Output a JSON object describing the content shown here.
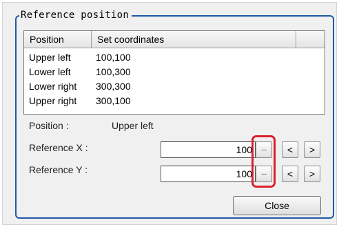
{
  "group": {
    "title": "Reference position"
  },
  "list": {
    "columns": [
      "Position",
      "Set coordinates",
      ""
    ],
    "rows": [
      {
        "position": "Upper left",
        "coords": "100,100"
      },
      {
        "position": "Lower left",
        "coords": "100,300"
      },
      {
        "position": "Lower right",
        "coords": "300,300"
      },
      {
        "position": "Upper right",
        "coords": "300,100"
      }
    ]
  },
  "position_info": {
    "label": "Position :",
    "value": "Upper left"
  },
  "reference_x": {
    "label": "Reference X :",
    "value": "100",
    "browse_label": "...",
    "decrement_label": "<",
    "increment_label": ">"
  },
  "reference_y": {
    "label": "Reference Y :",
    "value": "100",
    "browse_label": "...",
    "decrement_label": "<",
    "increment_label": ">"
  },
  "close_label": "Close",
  "colors": {
    "frame": "#1f5aa6",
    "highlight": "#d9212c",
    "panel_bg": "#f0f0f0"
  }
}
